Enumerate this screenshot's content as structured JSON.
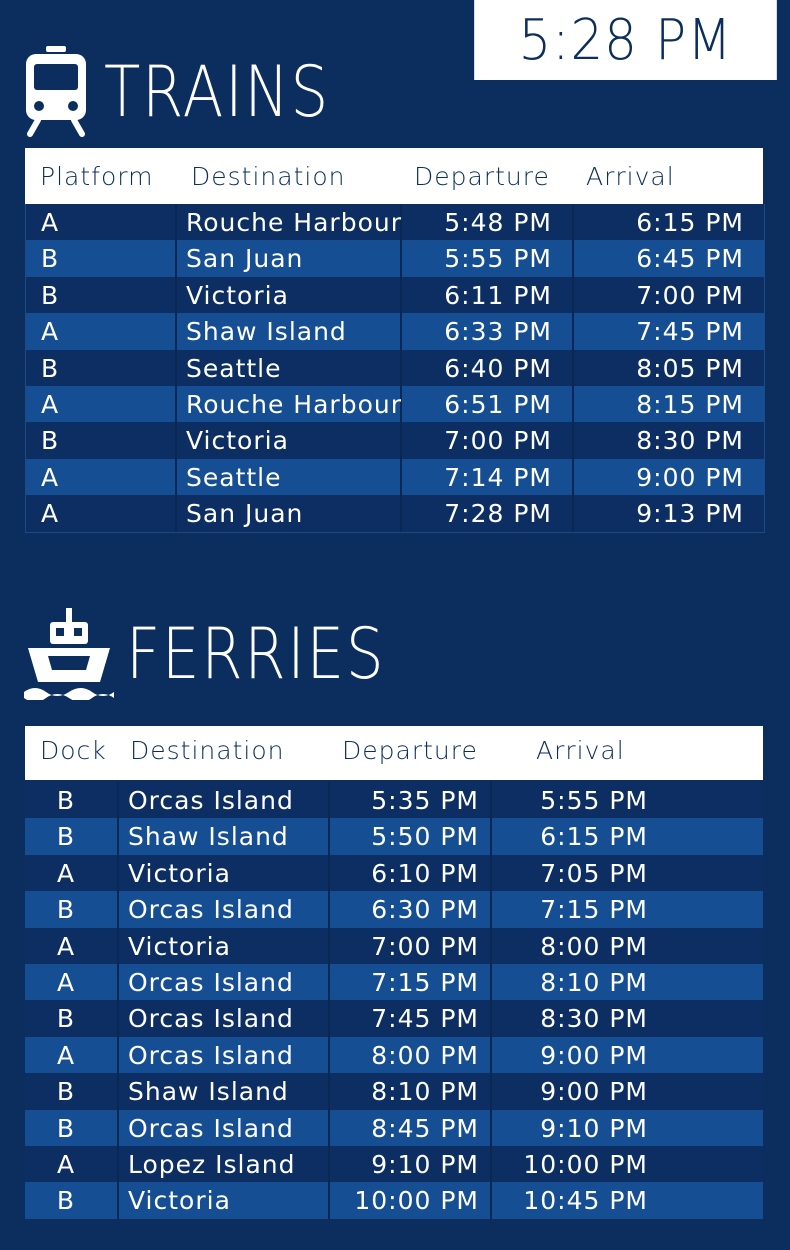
{
  "clock": "5:28 PM",
  "trains": {
    "title": "TRAINS",
    "icon": "train-icon",
    "headers": [
      "Platform",
      "Destination",
      "Departure",
      "Arrival"
    ],
    "rows": [
      [
        "A",
        "Rouche Harbour",
        "5:48 PM",
        "6:15 PM"
      ],
      [
        "B",
        "San Juan",
        "5:55 PM",
        "6:45 PM"
      ],
      [
        "B",
        "Victoria",
        "6:11 PM",
        "7:00 PM"
      ],
      [
        "A",
        "Shaw Island",
        "6:33 PM",
        "7:45 PM"
      ],
      [
        "B",
        "Seattle",
        "6:40 PM",
        "8:05 PM"
      ],
      [
        "A",
        "Rouche Harbour",
        "6:51 PM",
        "8:15 PM"
      ],
      [
        "B",
        "Victoria",
        "7:00 PM",
        "8:30 PM"
      ],
      [
        "A",
        "Seattle",
        "7:14 PM",
        "9:00 PM"
      ],
      [
        "A",
        "San Juan",
        "7:28 PM",
        "9:13 PM"
      ]
    ]
  },
  "ferries": {
    "title": "FERRIES",
    "icon": "ferry-icon",
    "headers": [
      "Dock",
      "Destination",
      "Departure",
      "Arrival"
    ],
    "rows": [
      [
        "B",
        "Orcas Island",
        "5:35 PM",
        "5:55 PM"
      ],
      [
        "B",
        "Shaw Island",
        "5:50 PM",
        "6:15 PM"
      ],
      [
        "A",
        "Victoria",
        "6:10 PM",
        "7:05 PM"
      ],
      [
        "B",
        "Orcas Island",
        "6:30 PM",
        "7:15 PM"
      ],
      [
        "A",
        "Victoria",
        "7:00 PM",
        "8:00 PM"
      ],
      [
        "A",
        "Orcas Island",
        "7:15 PM",
        "8:10 PM"
      ],
      [
        "B",
        "Orcas Island",
        "7:45 PM",
        "8:30 PM"
      ],
      [
        "A",
        "Orcas Island",
        "8:00 PM",
        "9:00 PM"
      ],
      [
        "B",
        "Shaw Island",
        "8:10 PM",
        "9:00 PM"
      ],
      [
        "B",
        "Orcas Island",
        "8:45 PM",
        "9:10 PM"
      ],
      [
        "A",
        "Lopez Island",
        "9:10 PM",
        "10:00 PM"
      ],
      [
        "B",
        "Victoria",
        "10:00 PM",
        "10:45 PM"
      ]
    ]
  },
  "colors": {
    "background": "#0b2e5e",
    "row_dark": "#0c2e62",
    "row_light": "#164e93",
    "header": "#ffffff"
  }
}
